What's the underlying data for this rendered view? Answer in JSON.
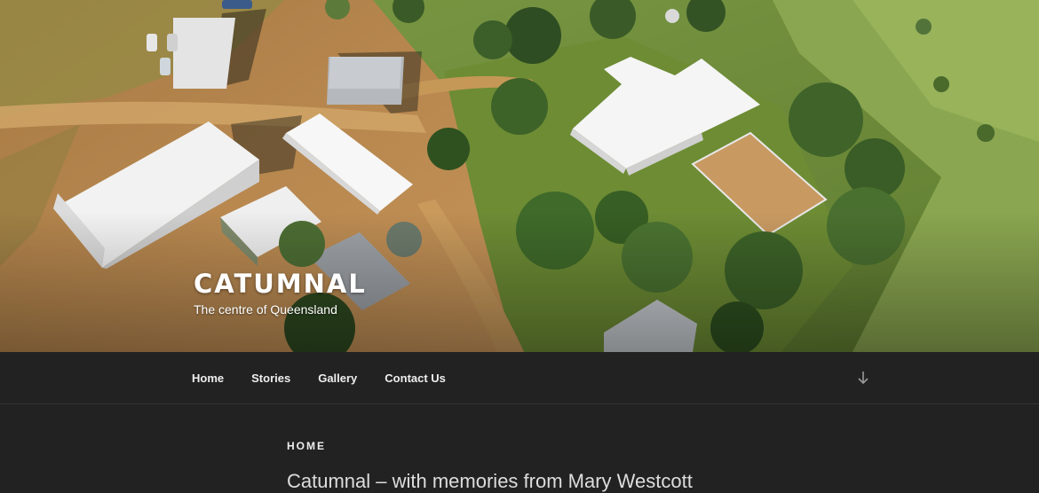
{
  "site": {
    "title": "CATUMNAL",
    "description": "The centre of Queensland"
  },
  "nav": {
    "items": [
      {
        "label": "Home"
      },
      {
        "label": "Stories"
      },
      {
        "label": "Gallery"
      },
      {
        "label": "Contact Us"
      }
    ],
    "scroll_icon": "arrow-down-icon"
  },
  "page": {
    "heading": "HOME",
    "entry_title": "Catumnal – with memories from Mary Westcott"
  },
  "colors": {
    "background": "#222222",
    "text": "#eeeeee",
    "grass": "#6f8a3a",
    "dirt": "#b98a4e",
    "roof": "#f4f4f4"
  }
}
